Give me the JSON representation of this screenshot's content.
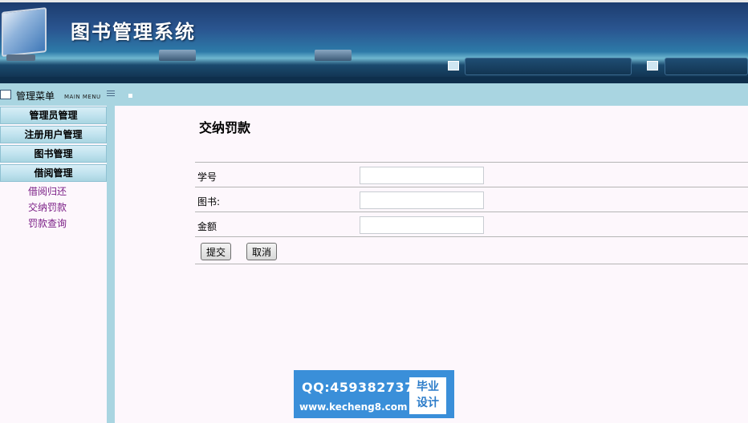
{
  "header": {
    "title": "图书管理系统"
  },
  "menubar": {
    "label": "管理菜单",
    "sub_label": "MAIN MENU"
  },
  "sidebar": {
    "groups": [
      {
        "label": "管理员管理"
      },
      {
        "label": "注册用户管理"
      },
      {
        "label": "图书管理"
      },
      {
        "label": "借阅管理"
      }
    ],
    "links": [
      {
        "label": "借阅归还"
      },
      {
        "label": "交纳罚款"
      },
      {
        "label": "罚款查询"
      }
    ]
  },
  "main": {
    "title": "交纳罚款",
    "fields": [
      {
        "label": "学号",
        "value": ""
      },
      {
        "label": "图书:",
        "value": ""
      },
      {
        "label": "金额",
        "value": ""
      }
    ],
    "submit_label": "提交",
    "cancel_label": "取消"
  },
  "watermark": {
    "qq": "QQ:459382737",
    "site": "www.kecheng8.com",
    "badge_line1": "毕业",
    "badge_line2": "设计"
  },
  "colors": {
    "menu_bg": "#a9d5e1",
    "page_bg": "#fdf7fc",
    "link": "#7b1f86",
    "watermark_bg": "#3a8fd9"
  }
}
